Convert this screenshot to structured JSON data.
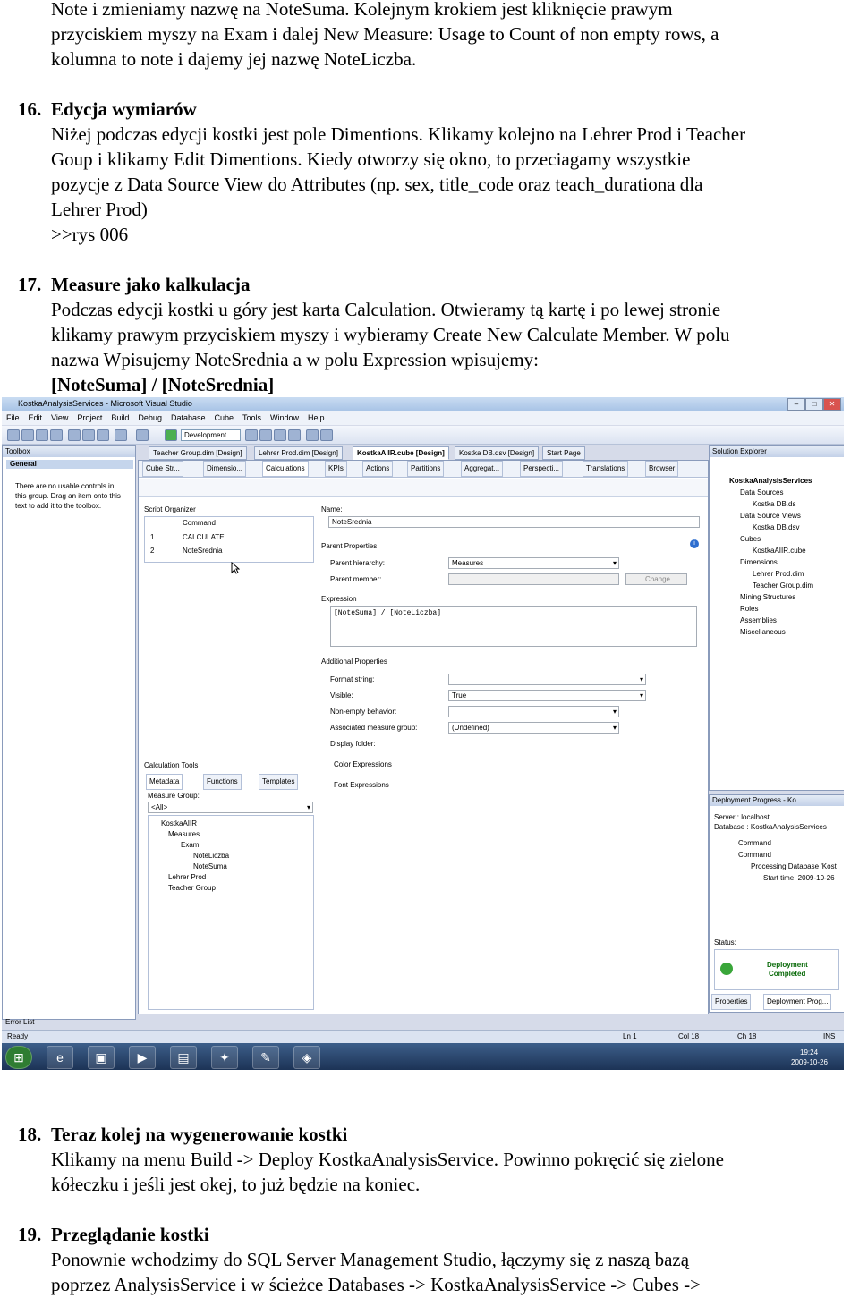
{
  "intro": {
    "line1": "Note i zmieniamy nazwę na NoteSuma. Kolejnym krokiem jest kliknięcie prawym",
    "line2": "przyciskiem myszy na Exam i dalej New Measure: Usage to Count of non empty rows, a",
    "line3": "kolumna to note i dajemy jej nazwę NoteLiczba."
  },
  "s16": {
    "num": "16.",
    "title": "Edycja wymiarów",
    "lines": [
      "Niżej podczas edycji kostki jest pole Dimentions. Klikamy kolejno na Lehrer Prod i Teacher",
      "Goup i klikamy Edit Dimentions. Kiedy otworzy się okno, to przeciagamy wszystkie",
      "pozycje z Data Source View do Attributes (np. sex, title_code oraz teach_durationa dla",
      "Lehrer Prod)",
      ">>rys 006"
    ]
  },
  "s17": {
    "num": "17.",
    "title": "Measure jako kalkulacja",
    "lines": [
      "Podczas edycji kostki u góry jest karta Calculation. Otwieramy tą kartę i po lewej stronie",
      "klikamy prawym przyciskiem myszy i wybieramy Create New Calculate Member. W polu",
      "nazwa Wpisujemy NoteSrednia a w polu Expression wpisujemy:"
    ],
    "formula": "[NoteSuma] / [NoteSrednia]"
  },
  "shot": {
    "window_title": "KostkaAnalysisServices - Microsoft Visual Studio",
    "menu": [
      "File",
      "Edit",
      "View",
      "Project",
      "Build",
      "Debug",
      "Database",
      "Cube",
      "Tools",
      "Window",
      "Help"
    ],
    "config": "Development",
    "toolbox": {
      "title": "Toolbox",
      "group": "General",
      "msg": [
        "There are no usable controls in",
        "this group. Drag an item onto this",
        "text to add it to the toolbox."
      ]
    },
    "doc_tabs": [
      "Teacher Group.dim [Design]",
      "Lehrer Prod.dim [Design]",
      "KostkaAIIR.cube [Design]",
      "Kostka DB.dsv [Design]",
      "Start Page"
    ],
    "designer_tabs": [
      "Cube Str...",
      "Dimensio...",
      "Calculations",
      "KPIs",
      "Actions",
      "Partitions",
      "Aggregat...",
      "Perspecti...",
      "Translations",
      "Browser"
    ],
    "script_organizer": {
      "title": "Script Organizer",
      "head": "Command",
      "rows": [
        [
          "1",
          "CALCULATE"
        ],
        [
          "2",
          "NoteSrednia"
        ]
      ]
    },
    "form": {
      "name_label": "Name:",
      "name_value": "NoteSrednia",
      "parent_props": "Parent Properties",
      "parent_hierarchy_label": "Parent hierarchy:",
      "parent_hierarchy_value": "Measures",
      "parent_member_label": "Parent member:",
      "change": "Change",
      "expression": "Expression",
      "expression_value": "[NoteSuma] / [NoteLiczba]",
      "additional": "Additional Properties",
      "format_string": "Format string:",
      "visible": "Visible:",
      "visible_value": "True",
      "nonempty": "Non-empty behavior:",
      "assoc_group": "Associated measure group:",
      "assoc_value": "(Undefined)",
      "display_folder": "Display folder:",
      "color_expr": "Color Expressions",
      "font_expr": "Font Expressions"
    },
    "calc_tools": {
      "title": "Calculation Tools",
      "tabs": [
        "Metadata",
        "Functions",
        "Templates"
      ],
      "group_label": "Measure Group:",
      "group_value": "<All>",
      "tree": [
        "KostkaAIIR",
        "Measures",
        "Exam",
        "NoteLiczba",
        "NoteSuma",
        "Lehrer Prod",
        "Teacher Group"
      ]
    },
    "solution": {
      "title": "Solution Explorer",
      "items": [
        "KostkaAnalysisServices",
        "Data Sources",
        "Kostka DB.ds",
        "Data Source Views",
        "Kostka DB.dsv",
        "Cubes",
        "KostkaAIIR.cube",
        "Dimensions",
        "Lehrer Prod.dim",
        "Teacher Group.dim",
        "Mining Structures",
        "Roles",
        "Assemblies",
        "Miscellaneous"
      ]
    },
    "deploy": {
      "title": "Deployment Progress - Ko...",
      "server": "Server : localhost",
      "database": "Database : KostkaAnalysisServices",
      "items": [
        "Command",
        "Command",
        "Processing Database 'Kost",
        "Start time: 2009-10-26"
      ],
      "status": "Status:",
      "done": [
        "Deployment",
        "Completed"
      ],
      "bottom_tabs": [
        "Properties",
        "Deployment Prog..."
      ]
    },
    "errorlist": "Error List",
    "status": {
      "ready": "Ready",
      "ln": "Ln 1",
      "col": "Col 18",
      "ch": "Ch 18",
      "ins": "INS"
    },
    "clock": {
      "time": "19:24",
      "date": "2009-10-26"
    }
  },
  "s18": {
    "num": "18.",
    "title": "Teraz kolej na wygenerowanie kostki",
    "lines": [
      "Klikamy na menu Build -> Deploy KostkaAnalysisService. Powinno pokręcić się zielone",
      "kółeczku i jeśli jest okej, to już będzie na koniec."
    ]
  },
  "s19": {
    "num": "19.",
    "title": "Przeglądanie kostki",
    "lines": [
      "Ponownie wchodzimy do SQL Server Management Studio, łączymy się z naszą bazą",
      "poprzez AnalysisService i w ścieżce Databases -> KostkaAnalysisService -> Cubes ->"
    ]
  }
}
